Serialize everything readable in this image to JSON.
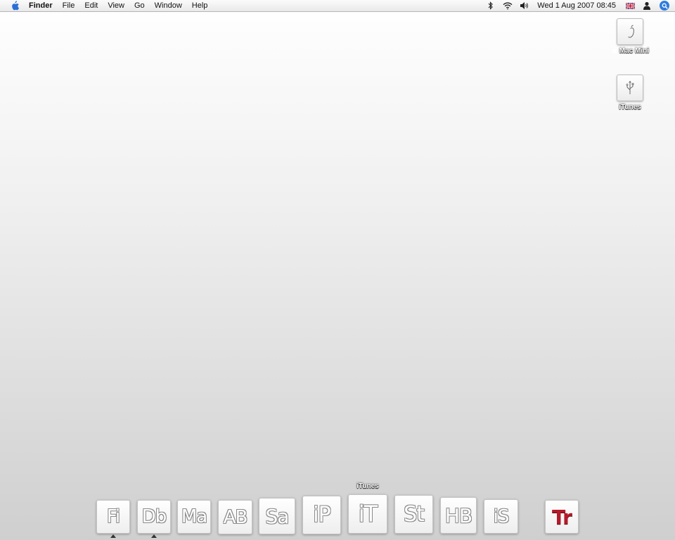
{
  "menubar": {
    "app_name": "Finder",
    "menus": [
      "File",
      "Edit",
      "View",
      "Go",
      "Window",
      "Help"
    ],
    "clock": "Wed 1 Aug 2007  08:45",
    "status_icons": [
      "bluetooth-icon",
      "wifi-icon",
      "volume-icon",
      "flag-uk-icon",
      "user-icon",
      "spotlight-icon"
    ],
    "spotlight_color": "#2f7ce0"
  },
  "desktop": {
    "icons": [
      {
        "label": "Mac Mini",
        "icon": "mac-mini-drive-icon"
      },
      {
        "label": "iTunes",
        "icon": "usb-drive-icon"
      }
    ]
  },
  "dock": {
    "tooltip": "iTunes",
    "items": [
      {
        "abbr": "Fi",
        "running": true
      },
      {
        "abbr": "Db",
        "running": true
      },
      {
        "abbr": "Ma",
        "running": false
      },
      {
        "abbr": "AB",
        "running": false
      },
      {
        "abbr": "Sa",
        "running": false
      },
      {
        "abbr": "iP",
        "running": false
      },
      {
        "abbr": "iT",
        "running": false
      },
      {
        "abbr": "St",
        "running": false
      },
      {
        "abbr": "HB",
        "running": false
      },
      {
        "abbr": "iS",
        "running": false
      },
      {
        "abbr": "Tr",
        "running": false,
        "accent": "#b31a2a"
      }
    ]
  }
}
